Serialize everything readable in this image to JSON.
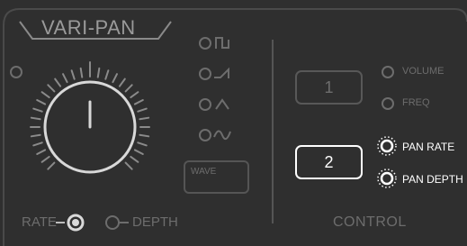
{
  "title": "VARI-PAN",
  "knob": {
    "labels": [
      "RATE",
      "DEPTH"
    ],
    "selected": "RATE"
  },
  "wave": {
    "label": "WAVE",
    "shapes": [
      "square-wave-icon",
      "sawtooth-wave-icon",
      "triangle-wave-icon",
      "sine-wave-icon"
    ]
  },
  "control": {
    "label": "CONTROL",
    "box1": "1",
    "box2": "2",
    "targets1": [
      "VOLUME",
      "FREQ"
    ],
    "targets2": [
      "PAN RATE",
      "PAN DEPTH"
    ]
  },
  "colors": {
    "background": "#2f2f2f",
    "dim": "#6d6d6d",
    "active": "#ffffff"
  }
}
